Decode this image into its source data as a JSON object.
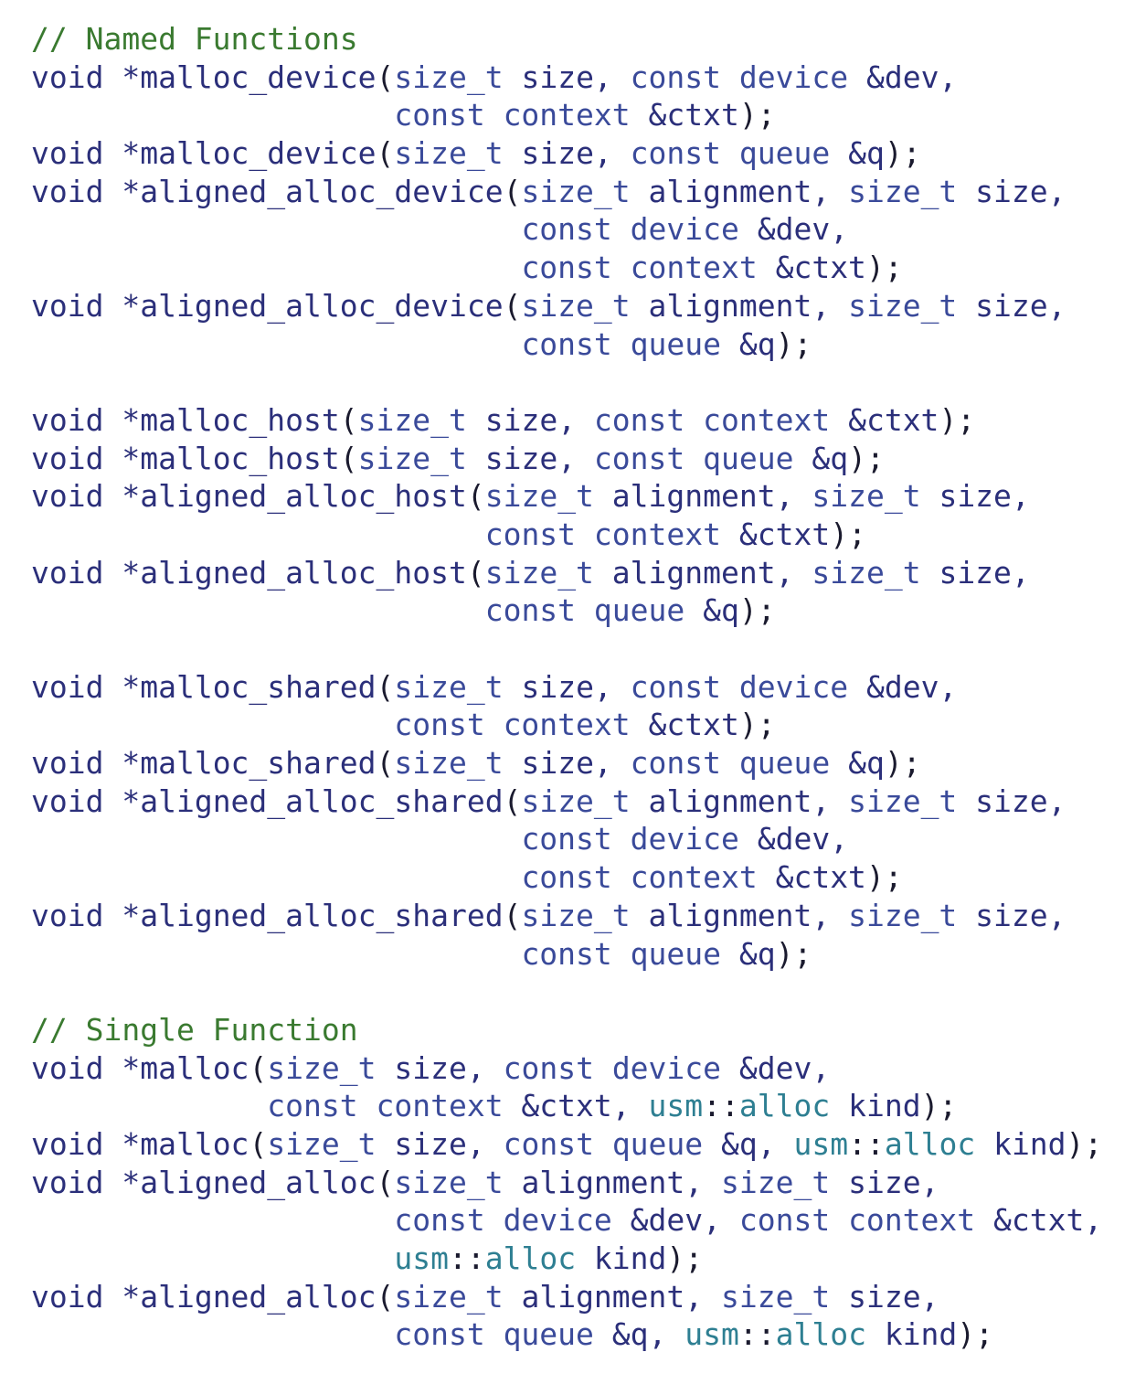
{
  "colors": {
    "comment": "#3a7a30",
    "keyword": "#2b2f7a",
    "function": "#7a5c2e",
    "type": "#3a4a9a",
    "namespace": "#2e7f92",
    "plain": "#2b2f7a",
    "punctuation": "#1a1a2e",
    "background": "#ffffff"
  },
  "lines": [
    {
      "tokens": [
        [
          "comment",
          "// Named Functions"
        ]
      ]
    },
    {
      "tokens": [
        [
          "keyword",
          "void "
        ],
        [
          "plain",
          "*"
        ],
        [
          "function",
          "malloc_device"
        ],
        [
          "punct",
          "("
        ],
        [
          "type",
          "size_t"
        ],
        [
          "plain",
          " size, "
        ],
        [
          "type",
          "const device"
        ],
        [
          "plain",
          " &dev,"
        ]
      ]
    },
    {
      "tokens": [
        [
          "plain",
          "                    "
        ],
        [
          "type",
          "const context"
        ],
        [
          "plain",
          " &ctxt"
        ],
        [
          "punct",
          ");"
        ]
      ]
    },
    {
      "tokens": [
        [
          "keyword",
          "void "
        ],
        [
          "plain",
          "*"
        ],
        [
          "function",
          "malloc_device"
        ],
        [
          "punct",
          "("
        ],
        [
          "type",
          "size_t"
        ],
        [
          "plain",
          " size, "
        ],
        [
          "type",
          "const queue"
        ],
        [
          "plain",
          " &q"
        ],
        [
          "punct",
          ");"
        ]
      ]
    },
    {
      "tokens": [
        [
          "keyword",
          "void "
        ],
        [
          "plain",
          "*"
        ],
        [
          "function",
          "aligned_alloc_device"
        ],
        [
          "punct",
          "("
        ],
        [
          "type",
          "size_t"
        ],
        [
          "plain",
          " alignment, "
        ],
        [
          "type",
          "size_t"
        ],
        [
          "plain",
          " size,"
        ]
      ]
    },
    {
      "tokens": [
        [
          "plain",
          "                           "
        ],
        [
          "type",
          "const device"
        ],
        [
          "plain",
          " &dev,"
        ]
      ]
    },
    {
      "tokens": [
        [
          "plain",
          "                           "
        ],
        [
          "type",
          "const context"
        ],
        [
          "plain",
          " &ctxt"
        ],
        [
          "punct",
          ");"
        ]
      ]
    },
    {
      "tokens": [
        [
          "keyword",
          "void "
        ],
        [
          "plain",
          "*"
        ],
        [
          "function",
          "aligned_alloc_device"
        ],
        [
          "punct",
          "("
        ],
        [
          "type",
          "size_t"
        ],
        [
          "plain",
          " alignment, "
        ],
        [
          "type",
          "size_t"
        ],
        [
          "plain",
          " size,"
        ]
      ]
    },
    {
      "tokens": [
        [
          "plain",
          "                           "
        ],
        [
          "type",
          "const queue"
        ],
        [
          "plain",
          " &q"
        ],
        [
          "punct",
          ");"
        ]
      ]
    },
    {
      "tokens": []
    },
    {
      "tokens": [
        [
          "keyword",
          "void "
        ],
        [
          "plain",
          "*"
        ],
        [
          "function",
          "malloc_host"
        ],
        [
          "punct",
          "("
        ],
        [
          "type",
          "size_t"
        ],
        [
          "plain",
          " size, "
        ],
        [
          "type",
          "const context"
        ],
        [
          "plain",
          " &ctxt"
        ],
        [
          "punct",
          ");"
        ]
      ]
    },
    {
      "tokens": [
        [
          "keyword",
          "void "
        ],
        [
          "plain",
          "*"
        ],
        [
          "function",
          "malloc_host"
        ],
        [
          "punct",
          "("
        ],
        [
          "type",
          "size_t"
        ],
        [
          "plain",
          " size, "
        ],
        [
          "type",
          "const queue"
        ],
        [
          "plain",
          " &q"
        ],
        [
          "punct",
          ");"
        ]
      ]
    },
    {
      "tokens": [
        [
          "keyword",
          "void "
        ],
        [
          "plain",
          "*"
        ],
        [
          "function",
          "aligned_alloc_host"
        ],
        [
          "punct",
          "("
        ],
        [
          "type",
          "size_t"
        ],
        [
          "plain",
          " alignment, "
        ],
        [
          "type",
          "size_t"
        ],
        [
          "plain",
          " size,"
        ]
      ]
    },
    {
      "tokens": [
        [
          "plain",
          "                         "
        ],
        [
          "type",
          "const context"
        ],
        [
          "plain",
          " &ctxt"
        ],
        [
          "punct",
          ");"
        ]
      ]
    },
    {
      "tokens": [
        [
          "keyword",
          "void "
        ],
        [
          "plain",
          "*"
        ],
        [
          "function",
          "aligned_alloc_host"
        ],
        [
          "punct",
          "("
        ],
        [
          "type",
          "size_t"
        ],
        [
          "plain",
          " alignment, "
        ],
        [
          "type",
          "size_t"
        ],
        [
          "plain",
          " size,"
        ]
      ]
    },
    {
      "tokens": [
        [
          "plain",
          "                         "
        ],
        [
          "type",
          "const queue"
        ],
        [
          "plain",
          " &q"
        ],
        [
          "punct",
          ");"
        ]
      ]
    },
    {
      "tokens": []
    },
    {
      "tokens": [
        [
          "keyword",
          "void "
        ],
        [
          "plain",
          "*"
        ],
        [
          "function",
          "malloc_shared"
        ],
        [
          "punct",
          "("
        ],
        [
          "type",
          "size_t"
        ],
        [
          "plain",
          " size, "
        ],
        [
          "type",
          "const device"
        ],
        [
          "plain",
          " &dev,"
        ]
      ]
    },
    {
      "tokens": [
        [
          "plain",
          "                    "
        ],
        [
          "type",
          "const context"
        ],
        [
          "plain",
          " &ctxt"
        ],
        [
          "punct",
          ");"
        ]
      ]
    },
    {
      "tokens": [
        [
          "keyword",
          "void "
        ],
        [
          "plain",
          "*"
        ],
        [
          "function",
          "malloc_shared"
        ],
        [
          "punct",
          "("
        ],
        [
          "type",
          "size_t"
        ],
        [
          "plain",
          " size, "
        ],
        [
          "type",
          "const queue"
        ],
        [
          "plain",
          " &q"
        ],
        [
          "punct",
          ");"
        ]
      ]
    },
    {
      "tokens": [
        [
          "keyword",
          "void "
        ],
        [
          "plain",
          "*"
        ],
        [
          "function",
          "aligned_alloc_shared"
        ],
        [
          "punct",
          "("
        ],
        [
          "type",
          "size_t"
        ],
        [
          "plain",
          " alignment, "
        ],
        [
          "type",
          "size_t"
        ],
        [
          "plain",
          " size,"
        ]
      ]
    },
    {
      "tokens": [
        [
          "plain",
          "                           "
        ],
        [
          "type",
          "const device"
        ],
        [
          "plain",
          " &dev,"
        ]
      ]
    },
    {
      "tokens": [
        [
          "plain",
          "                           "
        ],
        [
          "type",
          "const context"
        ],
        [
          "plain",
          " &ctxt"
        ],
        [
          "punct",
          ");"
        ]
      ]
    },
    {
      "tokens": [
        [
          "keyword",
          "void "
        ],
        [
          "plain",
          "*"
        ],
        [
          "function",
          "aligned_alloc_shared"
        ],
        [
          "punct",
          "("
        ],
        [
          "type",
          "size_t"
        ],
        [
          "plain",
          " alignment, "
        ],
        [
          "type",
          "size_t"
        ],
        [
          "plain",
          " size,"
        ]
      ]
    },
    {
      "tokens": [
        [
          "plain",
          "                           "
        ],
        [
          "type",
          "const queue"
        ],
        [
          "plain",
          " &q"
        ],
        [
          "punct",
          ");"
        ]
      ]
    },
    {
      "tokens": []
    },
    {
      "tokens": [
        [
          "comment",
          "// Single Function"
        ]
      ]
    },
    {
      "tokens": [
        [
          "keyword",
          "void "
        ],
        [
          "plain",
          "*"
        ],
        [
          "function",
          "malloc"
        ],
        [
          "punct",
          "("
        ],
        [
          "type",
          "size_t"
        ],
        [
          "plain",
          " size, "
        ],
        [
          "type",
          "const device"
        ],
        [
          "plain",
          " &dev,"
        ]
      ]
    },
    {
      "tokens": [
        [
          "plain",
          "             "
        ],
        [
          "type",
          "const context"
        ],
        [
          "plain",
          " &ctxt, "
        ],
        [
          "ns",
          "usm"
        ],
        [
          "punct",
          "::"
        ],
        [
          "ns",
          "alloc"
        ],
        [
          "plain",
          " kind"
        ],
        [
          "punct",
          ");"
        ]
      ]
    },
    {
      "tokens": [
        [
          "keyword",
          "void "
        ],
        [
          "plain",
          "*"
        ],
        [
          "function",
          "malloc"
        ],
        [
          "punct",
          "("
        ],
        [
          "type",
          "size_t"
        ],
        [
          "plain",
          " size, "
        ],
        [
          "type",
          "const queue"
        ],
        [
          "plain",
          " &q, "
        ],
        [
          "ns",
          "usm"
        ],
        [
          "punct",
          "::"
        ],
        [
          "ns",
          "alloc"
        ],
        [
          "plain",
          " kind"
        ],
        [
          "punct",
          ");"
        ]
      ]
    },
    {
      "tokens": [
        [
          "keyword",
          "void "
        ],
        [
          "plain",
          "*"
        ],
        [
          "function",
          "aligned_alloc"
        ],
        [
          "punct",
          "("
        ],
        [
          "type",
          "size_t"
        ],
        [
          "plain",
          " alignment, "
        ],
        [
          "type",
          "size_t"
        ],
        [
          "plain",
          " size,"
        ]
      ]
    },
    {
      "tokens": [
        [
          "plain",
          "                    "
        ],
        [
          "type",
          "const device"
        ],
        [
          "plain",
          " &dev, "
        ],
        [
          "type",
          "const context"
        ],
        [
          "plain",
          " &ctxt,"
        ]
      ]
    },
    {
      "tokens": [
        [
          "plain",
          "                    "
        ],
        [
          "ns",
          "usm"
        ],
        [
          "punct",
          "::"
        ],
        [
          "ns",
          "alloc"
        ],
        [
          "plain",
          " kind"
        ],
        [
          "punct",
          ");"
        ]
      ]
    },
    {
      "tokens": [
        [
          "keyword",
          "void "
        ],
        [
          "plain",
          "*"
        ],
        [
          "function",
          "aligned_alloc"
        ],
        [
          "punct",
          "("
        ],
        [
          "type",
          "size_t"
        ],
        [
          "plain",
          " alignment, "
        ],
        [
          "type",
          "size_t"
        ],
        [
          "plain",
          " size,"
        ]
      ]
    },
    {
      "tokens": [
        [
          "plain",
          "                    "
        ],
        [
          "type",
          "const queue"
        ],
        [
          "plain",
          " &q, "
        ],
        [
          "ns",
          "usm"
        ],
        [
          "punct",
          "::"
        ],
        [
          "ns",
          "alloc"
        ],
        [
          "plain",
          " kind"
        ],
        [
          "punct",
          ");"
        ]
      ]
    }
  ]
}
